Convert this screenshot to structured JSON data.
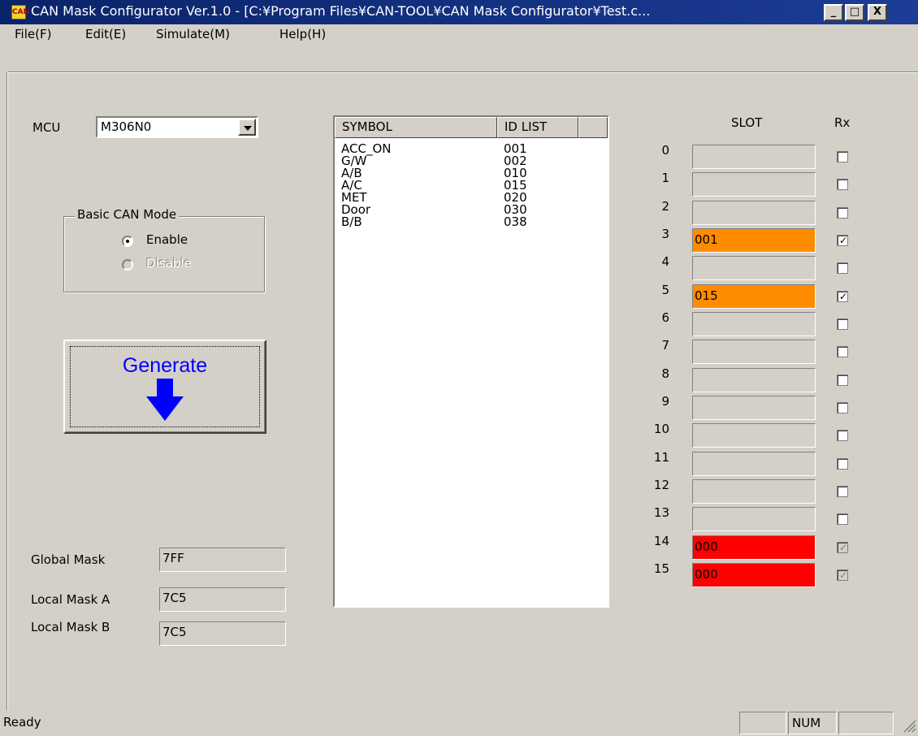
{
  "window": {
    "title": "CAN Mask Configurator Ver.1.0 - [C:¥Program Files¥CAN-TOOL¥CAN Mask Configurator¥Test.c...",
    "icon_text": "CAN",
    "minimize_glyph": "_",
    "maximize_glyph": "□",
    "close_glyph": "X"
  },
  "menu": [
    {
      "label": "File(F)"
    },
    {
      "label": "Edit(E)"
    },
    {
      "label": "Simulate(M)"
    },
    {
      "label": "Help(H)"
    }
  ],
  "mcu": {
    "label": "MCU",
    "value": "M306N0"
  },
  "basic_can": {
    "title": "Basic CAN Mode",
    "enable_label": "Enable",
    "disable_label": "Disable",
    "selected": "Enable"
  },
  "generate": {
    "label": "Generate"
  },
  "masks": [
    {
      "label": "Global Mask",
      "value": "7FF"
    },
    {
      "label": "Local Mask A",
      "value": "7C5"
    },
    {
      "label": "Local Mask B",
      "value": "7C5"
    }
  ],
  "id_list": {
    "headers": [
      "SYMBOL",
      "ID LIST"
    ],
    "rows": [
      {
        "symbol": "ACC_ON",
        "id": "001"
      },
      {
        "symbol": "G/W",
        "id": "002"
      },
      {
        "symbol": "A/B",
        "id": "010"
      },
      {
        "symbol": "A/C",
        "id": "015"
      },
      {
        "symbol": "MET",
        "id": "020"
      },
      {
        "symbol": "Door",
        "id": "030"
      },
      {
        "symbol": "B/B",
        "id": "038"
      }
    ]
  },
  "slots": {
    "header": "SLOT",
    "rx_header": "Rx",
    "items": [
      {
        "num": "0",
        "value": "",
        "color": "#d4d0c8",
        "rx": false,
        "rx_disabled": false
      },
      {
        "num": "1",
        "value": "",
        "color": "#d4d0c8",
        "rx": false,
        "rx_disabled": false
      },
      {
        "num": "2",
        "value": "",
        "color": "#d4d0c8",
        "rx": false,
        "rx_disabled": false
      },
      {
        "num": "3",
        "value": "001",
        "color": "#ff8c00",
        "rx": true,
        "rx_disabled": false
      },
      {
        "num": "4",
        "value": "",
        "color": "#d4d0c8",
        "rx": false,
        "rx_disabled": false
      },
      {
        "num": "5",
        "value": "015",
        "color": "#ff8c00",
        "rx": true,
        "rx_disabled": false
      },
      {
        "num": "6",
        "value": "",
        "color": "#d4d0c8",
        "rx": false,
        "rx_disabled": false
      },
      {
        "num": "7",
        "value": "",
        "color": "#d4d0c8",
        "rx": false,
        "rx_disabled": false
      },
      {
        "num": "8",
        "value": "",
        "color": "#d4d0c8",
        "rx": false,
        "rx_disabled": false
      },
      {
        "num": "9",
        "value": "",
        "color": "#d4d0c8",
        "rx": false,
        "rx_disabled": false
      },
      {
        "num": "10",
        "value": "",
        "color": "#d4d0c8",
        "rx": false,
        "rx_disabled": false
      },
      {
        "num": "11",
        "value": "",
        "color": "#d4d0c8",
        "rx": false,
        "rx_disabled": false
      },
      {
        "num": "12",
        "value": "",
        "color": "#d4d0c8",
        "rx": false,
        "rx_disabled": false
      },
      {
        "num": "13",
        "value": "",
        "color": "#d4d0c8",
        "rx": false,
        "rx_disabled": false
      },
      {
        "num": "14",
        "value": "000",
        "color": "#ff0000",
        "rx": true,
        "rx_disabled": true
      },
      {
        "num": "15",
        "value": "000",
        "color": "#ff0000",
        "rx": true,
        "rx_disabled": true
      }
    ]
  },
  "status": {
    "text": "Ready",
    "panes": [
      "",
      "NUM",
      ""
    ]
  }
}
